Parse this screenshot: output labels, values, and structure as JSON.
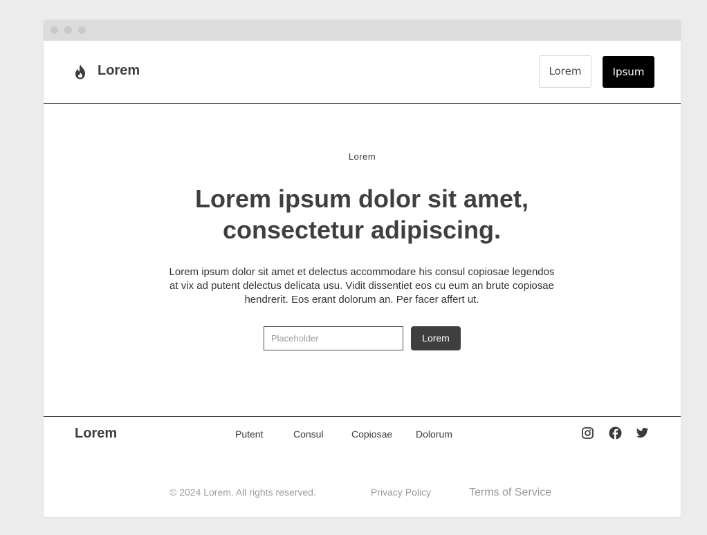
{
  "header": {
    "logo_icon": "flame-icon",
    "brand": "Lorem",
    "secondary_button": "Lorem",
    "primary_button": "Ipsum"
  },
  "hero": {
    "eyebrow": "Lorem",
    "title_line1": "Lorem ipsum dolor sit amet,",
    "title_line2": "consectetur adipiscing.",
    "body": "Lorem ipsum dolor sit amet et delectus accommodare his consul copiosae legendos at vix ad putent delectus delicata usu. Vidit dissentiet eos cu eum an brute copiosae hendrerit. Eos erant dolorum an. Per facer affert ut.",
    "input_placeholder": "Placeholder",
    "input_value": "",
    "submit_button": "Lorem"
  },
  "footer": {
    "brand": "Lorem",
    "links": [
      "Putent",
      "Consul",
      "Copiosae",
      "Dolorum"
    ],
    "social_icons": [
      "instagram-icon",
      "facebook-icon",
      "twitter-icon"
    ],
    "copyright": "© 2024 Lorem. All rights reserved.",
    "privacy": "Privacy Policy",
    "terms": "Terms of Service"
  },
  "colors": {
    "primary_button_bg": "#000000",
    "submit_button_bg": "#3f3f3f",
    "text": "#3f3f3f",
    "muted_text": "#9a9a9a",
    "page_bg": "#ececec"
  }
}
